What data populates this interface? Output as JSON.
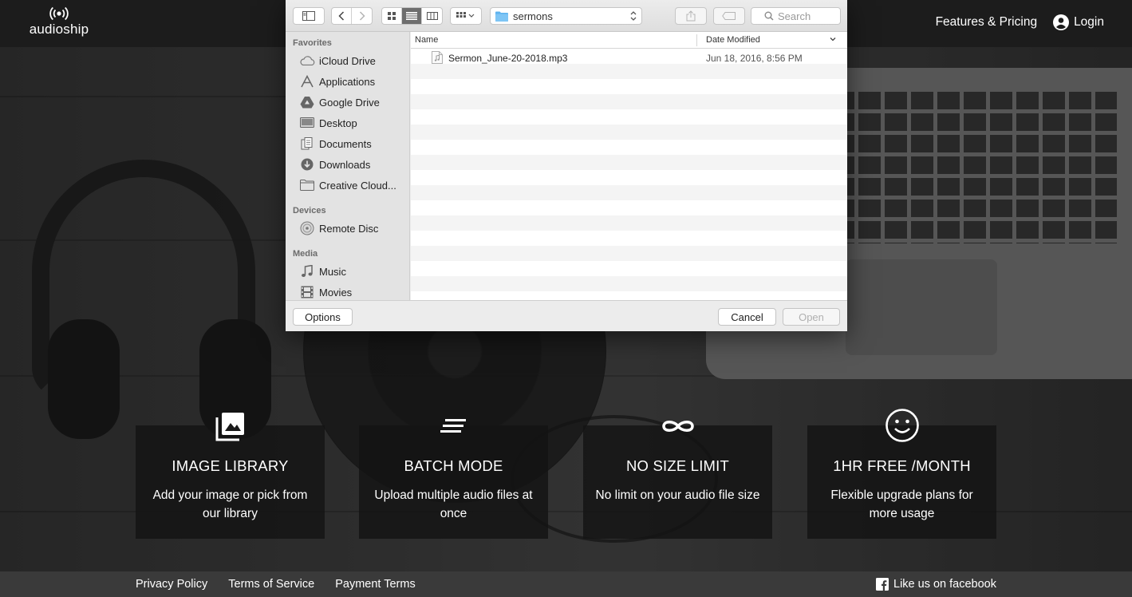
{
  "site": {
    "logo_text": "audioship",
    "nav": {
      "features": "Features & Pricing",
      "login": "Login"
    }
  },
  "features": [
    {
      "icon": "image-library-icon",
      "title": "IMAGE LIBRARY",
      "desc": "Add your image or pick from our library"
    },
    {
      "icon": "batch-mode-icon",
      "title": "BATCH MODE",
      "desc": "Upload multiple audio files at once"
    },
    {
      "icon": "infinity-icon",
      "title": "NO SIZE LIMIT",
      "desc": "No limit on your audio file size"
    },
    {
      "icon": "smiley-icon",
      "title": "1HR FREE /MONTH",
      "desc": "Flexible upgrade plans for more usage"
    }
  ],
  "footer": {
    "links": [
      "Privacy Policy",
      "Terms of Service",
      "Payment Terms"
    ],
    "facebook": "Like us on facebook"
  },
  "dialog": {
    "location": "sermons",
    "search_placeholder": "Search",
    "sidebar": {
      "favorites_label": "Favorites",
      "favorites": [
        {
          "label": "iCloud Drive",
          "icon": "icloud-icon"
        },
        {
          "label": "Applications",
          "icon": "applications-icon"
        },
        {
          "label": "Google Drive",
          "icon": "google-drive-icon"
        },
        {
          "label": "Desktop",
          "icon": "desktop-icon"
        },
        {
          "label": "Documents",
          "icon": "documents-icon"
        },
        {
          "label": "Downloads",
          "icon": "downloads-icon"
        },
        {
          "label": "Creative Cloud...",
          "icon": "folder-icon"
        }
      ],
      "devices_label": "Devices",
      "devices": [
        {
          "label": "Remote Disc",
          "icon": "remote-disc-icon"
        }
      ],
      "media_label": "Media",
      "media": [
        {
          "label": "Music",
          "icon": "music-icon"
        },
        {
          "label": "Movies",
          "icon": "movies-icon"
        }
      ]
    },
    "columns": {
      "name": "Name",
      "date": "Date Modified"
    },
    "files": [
      {
        "name": "Sermon_June-20-2018.mp3",
        "date": "Jun 18, 2016, 8:56 PM"
      }
    ],
    "buttons": {
      "options": "Options",
      "cancel": "Cancel",
      "open": "Open"
    }
  },
  "colors": {
    "topbar": "#1c1c1c",
    "card": "#141414",
    "footer": "#3a3a3a"
  }
}
